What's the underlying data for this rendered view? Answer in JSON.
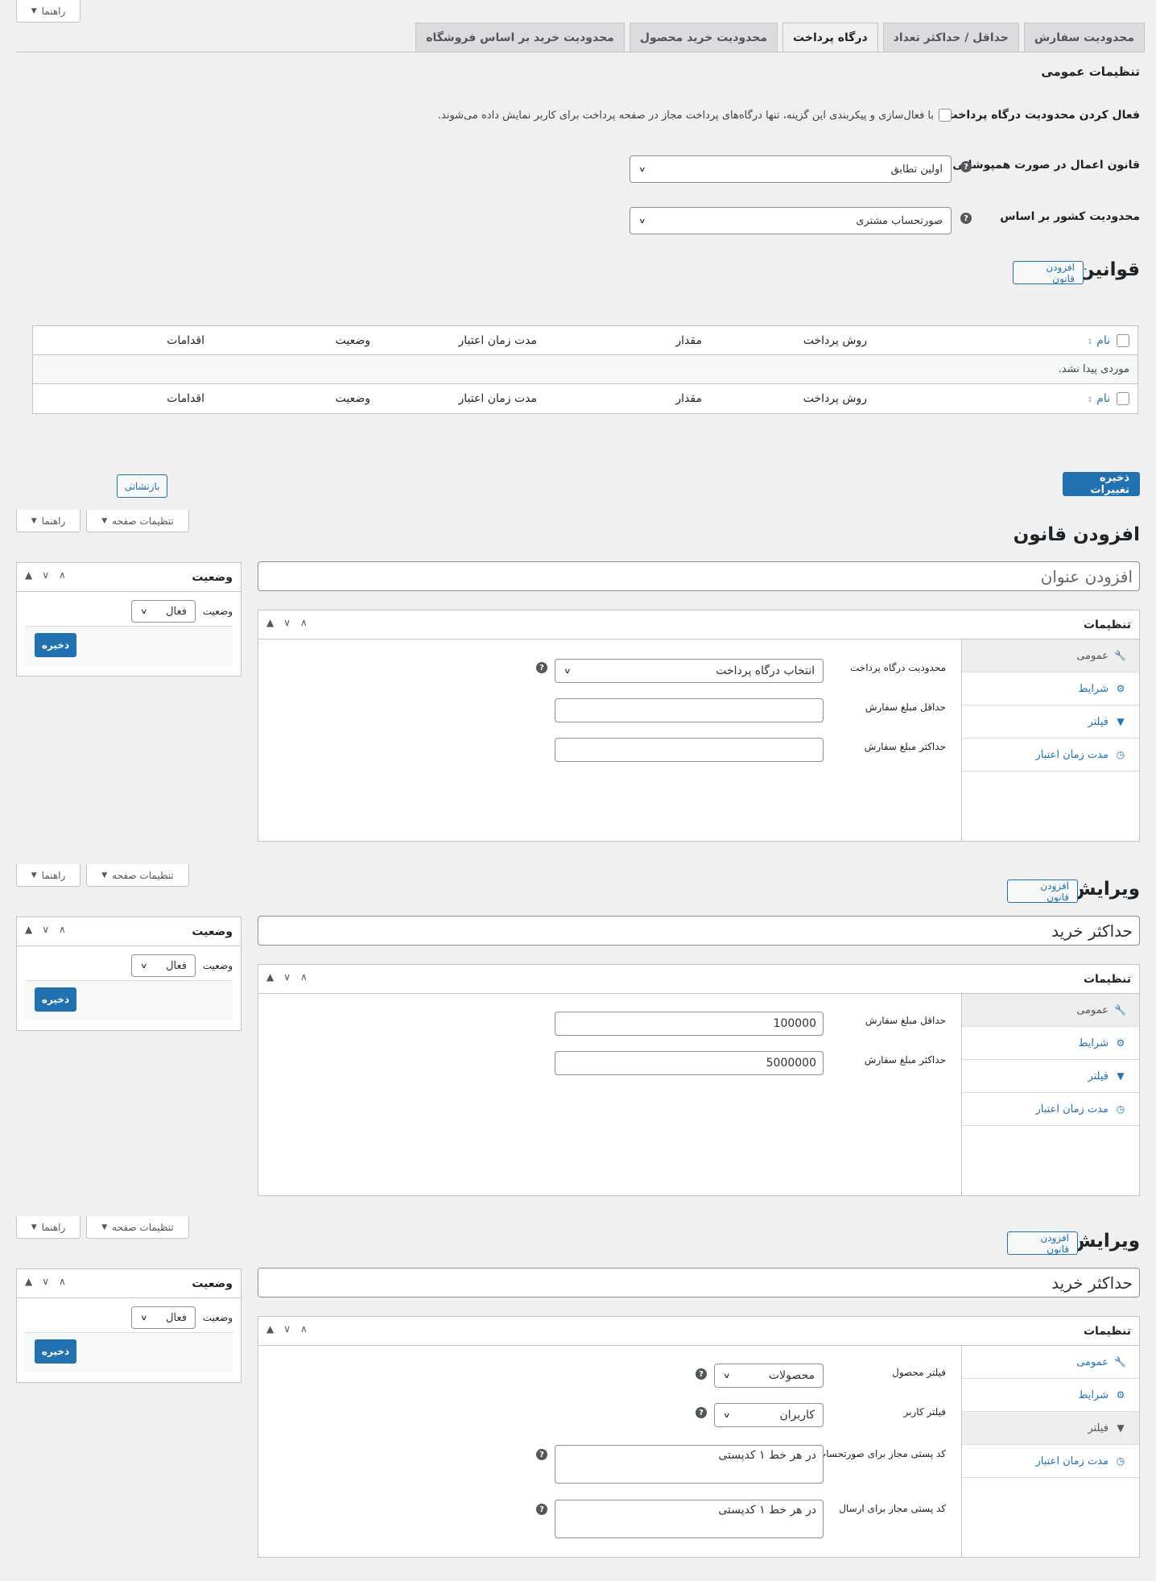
{
  "top": {
    "help_label": "راهنما"
  },
  "tabs": [
    {
      "label": "محدودیت سفارش"
    },
    {
      "label": "حداقل / حداکثر تعداد"
    },
    {
      "label": "درگاه پرداخت"
    },
    {
      "label": "محدودیت خرید محصول"
    },
    {
      "label": "محدودیت خرید بر اساس فروشگاه"
    }
  ],
  "general": {
    "heading": "تنظیمات عمومی",
    "enable_label": "فعال کردن محدودیت درگاه پرداخت",
    "enable_desc": "با فعال‌سازی و پیکربندی این گزینه، تنها درگاه‌های پرداخت مجاز در صفحه پرداخت برای کاربر نمایش داده می‌شوند.",
    "overlap_label": "قانون اعمال در صورت همپوشانی",
    "overlap_value": "اولین تطابق",
    "country_label": "محدودیت کشور بر اساس",
    "country_value": "صورتحساب مشتری",
    "help_glyph": "?"
  },
  "rules": {
    "title": "قوانین",
    "add_label": "افزودن قانون",
    "columns": {
      "name": "نام",
      "method": "روش پرداخت",
      "amount": "مقدار",
      "validity": "مدت زمان اعتبار",
      "status": "وضعیت",
      "actions": "اقدامات"
    },
    "empty": "موردی پیدا نشد.",
    "save_label": "ذخیره تغییرات",
    "reset_label": "بازنشانی"
  },
  "screen_options": "تنظیمات صفحه",
  "section1": {
    "heading": "افزودن قانون",
    "title_placeholder": "افزودن عنوان",
    "settings_title": "تنظیمات",
    "status_box": "وضعیت",
    "status_label": "وضعیت",
    "status_value": "فعال",
    "save": "ذخیره",
    "tabs": [
      "عمومی",
      "شرایط",
      "فیلتر",
      "مدت زمان اعتبار"
    ],
    "gateway_label": "محدودیت درگاه پرداخت",
    "gateway_value": "انتخاب درگاه پرداخت",
    "min_label": "حداقل مبلغ سفارش",
    "max_label": "حداکثر مبلغ سفارش"
  },
  "section2": {
    "heading": "ویرایش",
    "add_label": "افزودن قانون",
    "title_value": "حداکثر خرید",
    "settings_title": "تنظیمات",
    "status_box": "وضعیت",
    "status_label": "وضعیت",
    "status_value": "فعال",
    "save": "ذخیره",
    "tabs": [
      "عمومی",
      "شرایط",
      "فیلتر",
      "مدت زمان اعتبار"
    ],
    "min_label": "حداقل مبلغ سفارش",
    "min_value": "100000",
    "max_label": "حداکثر مبلغ سفارش",
    "max_value": "5000000"
  },
  "section3": {
    "heading": "ویرایش",
    "add_label": "افزودن قانون",
    "title_value": "حداکثر خرید",
    "settings_title": "تنظیمات",
    "status_box": "وضعیت",
    "status_label": "وضعیت",
    "status_value": "فعال",
    "save": "ذخیره",
    "tabs": [
      "عمومی",
      "شرایط",
      "فیلتر",
      "مدت زمان اعتبار"
    ],
    "product_filter_label": "فیلتر محصول",
    "product_filter_value": "محصولات",
    "user_filter_label": "فیلتر کاربر",
    "user_filter_value": "کاربران",
    "billing_zip_label": "کد پستی مجاز برای صورتحساب",
    "billing_zip_value": "در هر خط ۱ کدپستی",
    "shipping_zip_label": "کد پستی مجاز برای ارسال",
    "shipping_zip_value": "در هر خط ۱ کدپستی"
  },
  "colors": {
    "accent": "#2271b1",
    "bg": "#f0f0f1"
  }
}
